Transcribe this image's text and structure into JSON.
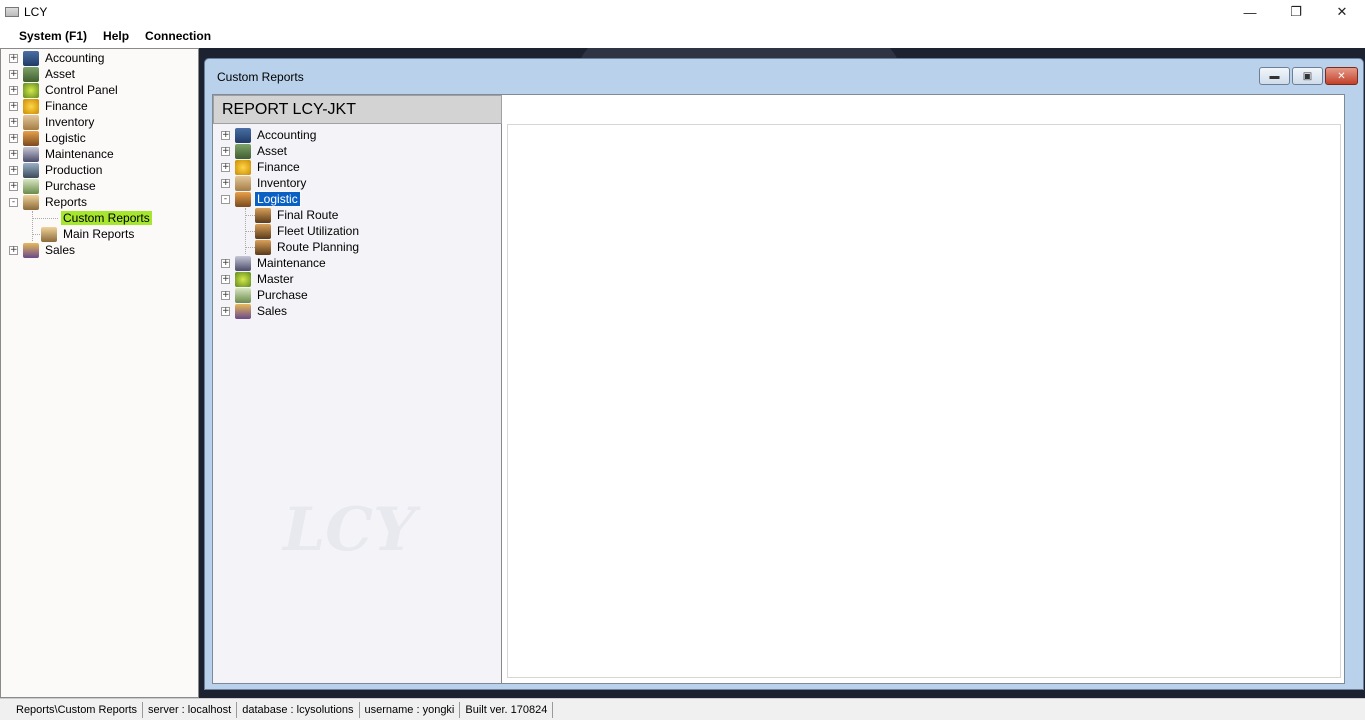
{
  "window": {
    "title": "LCY"
  },
  "menu": [
    "System (F1)",
    "Help",
    "Connection"
  ],
  "nav_tree": [
    {
      "label": "Accounting",
      "icon": "accounting-icon",
      "expander": "+"
    },
    {
      "label": "Asset",
      "icon": "asset-icon",
      "expander": "+"
    },
    {
      "label": "Control Panel",
      "icon": "control-panel-icon",
      "expander": "+"
    },
    {
      "label": "Finance",
      "icon": "finance-icon",
      "expander": "+"
    },
    {
      "label": "Inventory",
      "icon": "inventory-icon",
      "expander": "+"
    },
    {
      "label": "Logistic",
      "icon": "logistic-icon",
      "expander": "+"
    },
    {
      "label": "Maintenance",
      "icon": "maintenance-icon",
      "expander": "+"
    },
    {
      "label": "Production",
      "icon": "production-icon",
      "expander": "+"
    },
    {
      "label": "Purchase",
      "icon": "purchase-icon",
      "expander": "+"
    },
    {
      "label": "Reports",
      "icon": "reports-icon",
      "expander": "-"
    },
    {
      "label": "Custom Reports",
      "child": true,
      "selected": true
    },
    {
      "label": "Main Reports",
      "icon": "main-reports-icon",
      "child": true
    },
    {
      "label": "Sales",
      "icon": "sales-icon",
      "expander": "+"
    }
  ],
  "mdi": {
    "title": "Custom Reports",
    "report_header": "REPORT LCY-JKT",
    "report_tree": [
      {
        "label": "Accounting",
        "icon": "accounting-icon",
        "expander": "+"
      },
      {
        "label": "Asset",
        "icon": "asset-icon",
        "expander": "+"
      },
      {
        "label": "Finance",
        "icon": "finance-icon",
        "expander": "+"
      },
      {
        "label": "Inventory",
        "icon": "inventory-icon",
        "expander": "+"
      },
      {
        "label": "Logistic",
        "icon": "logistic-icon",
        "expander": "-",
        "selected": true
      },
      {
        "label": "Final Route",
        "icon": "route-icon",
        "child": true
      },
      {
        "label": "Fleet Utilization",
        "icon": "route-icon",
        "child": true
      },
      {
        "label": "Route Planning",
        "icon": "route-icon",
        "child": true
      },
      {
        "label": "Maintenance",
        "icon": "maintenance-icon",
        "expander": "+"
      },
      {
        "label": "Master",
        "icon": "master-icon",
        "expander": "+"
      },
      {
        "label": "Purchase",
        "icon": "purchase-icon",
        "expander": "+"
      },
      {
        "label": "Sales",
        "icon": "sales-icon",
        "expander": "+"
      }
    ]
  },
  "status_bar": [
    "Reports\\Custom Reports",
    "server : localhost",
    "database : lcysolutions",
    "username : yongki",
    "Built ver. 170824"
  ],
  "watermark_text": "LCY",
  "colors": {
    "selected_green": "#a6e62e",
    "selected_blue": "#0a5fc2",
    "mdi_frame": "#b9d1ea",
    "close_button": "#c2402a"
  }
}
